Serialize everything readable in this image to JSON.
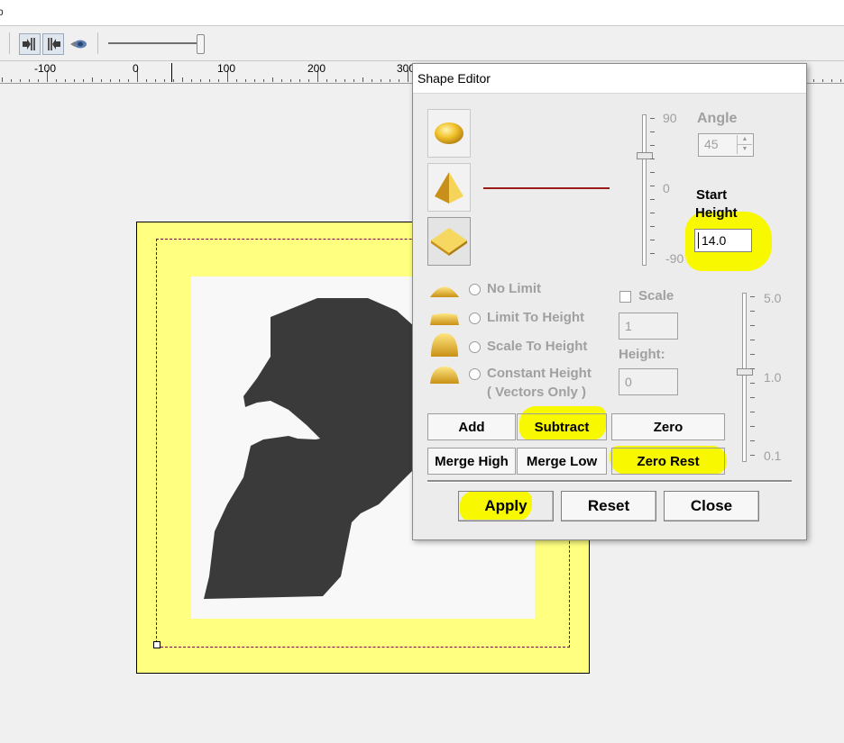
{
  "app": {
    "title_stub": "b"
  },
  "ruler": {
    "labels": [
      "-100",
      "0",
      "100",
      "200",
      "300"
    ]
  },
  "dialog": {
    "title": "Shape Editor",
    "shapes": [
      {
        "name": "round-shape",
        "selected": false
      },
      {
        "name": "pyramid-shape",
        "selected": false
      },
      {
        "name": "diamond-shape",
        "selected": true
      }
    ],
    "angle_slider": {
      "top_label": "90",
      "mid_label": "0",
      "bottom_label": "-90"
    },
    "angle": {
      "label": "Angle",
      "value": "45"
    },
    "start_height": {
      "label_line1": "Start",
      "label_line2": "Height",
      "value": "14.0"
    },
    "limits": {
      "no_limit": "No Limit",
      "limit_to_height": "Limit To Height",
      "scale_to_height": "Scale To Height",
      "constant_height": "Constant Height",
      "vectors_only": "( Vectors Only )"
    },
    "scale": {
      "label": "Scale",
      "value": "1",
      "checked": false
    },
    "height": {
      "label": "Height:",
      "value": "0"
    },
    "scale_slider": {
      "top_label": "5.0",
      "mid_label": "1.0",
      "bottom_label": "0.1"
    },
    "buttons": {
      "add": "Add",
      "subtract": "Subtract",
      "zero": "Zero",
      "merge_high": "Merge High",
      "merge_low": "Merge Low",
      "zero_rest": "Zero Rest",
      "apply": "Apply",
      "reset": "Reset",
      "close": "Close"
    },
    "colors": {
      "highlight": "#f8f800",
      "profile_line": "#9b1b1b",
      "gold": "#e8b820"
    }
  },
  "canvas": {
    "colors": {
      "border": "#ffff80",
      "background": "#f8f8f8",
      "shape": "#3a3a3a",
      "selection": "#7a0064"
    }
  }
}
